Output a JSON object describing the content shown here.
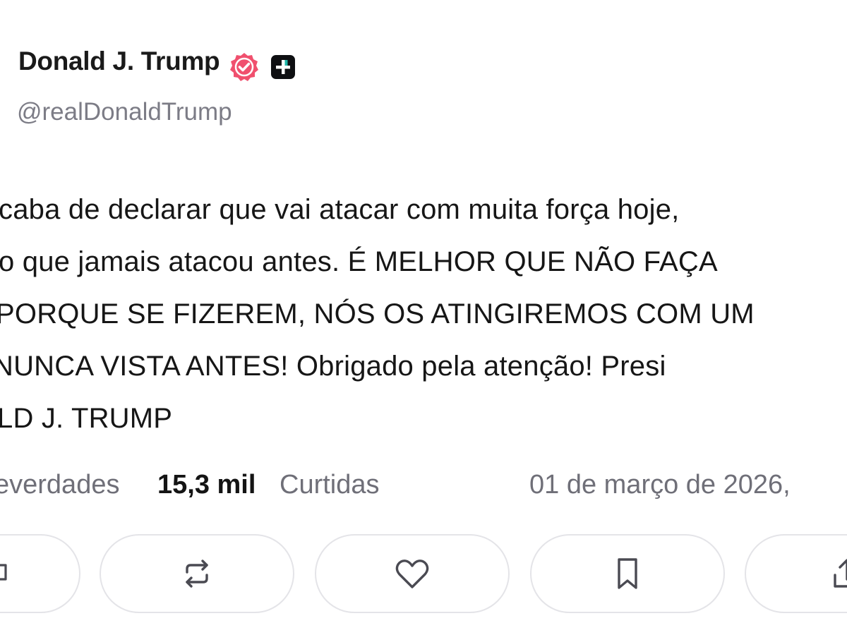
{
  "author": {
    "name": "Donald J. Trump",
    "handle": "@realDonaldTrump",
    "verified_icon": "verified-badge-icon",
    "badge_icon": "plus-square-icon"
  },
  "post": {
    "lines": [
      "caba de declarar que vai atacar com muita força hoje,",
      "o que jamais atacou antes. É MELHOR QUE NÃO FAÇA",
      "PORQUE SE FIZEREM, NÓS OS ATINGIREMOS COM UM",
      " NUNCA VISTA ANTES! Obrigado pela atenção! Presi",
      "LD J. TRUMP"
    ]
  },
  "stats": {
    "retruths_label": "everdades",
    "likes_value": "15,3 mil",
    "likes_label": "Curtidas",
    "date": "01 de março de 2026,"
  },
  "actions": {
    "icons": [
      "reply-icon",
      "retruth-icon",
      "heart-icon",
      "bookmark-icon",
      "share-icon"
    ]
  },
  "colors": {
    "verified": "#f0506e",
    "muted_text": "#6f6f78",
    "border": "#e4e4e8",
    "icon": "#4a4a52"
  }
}
